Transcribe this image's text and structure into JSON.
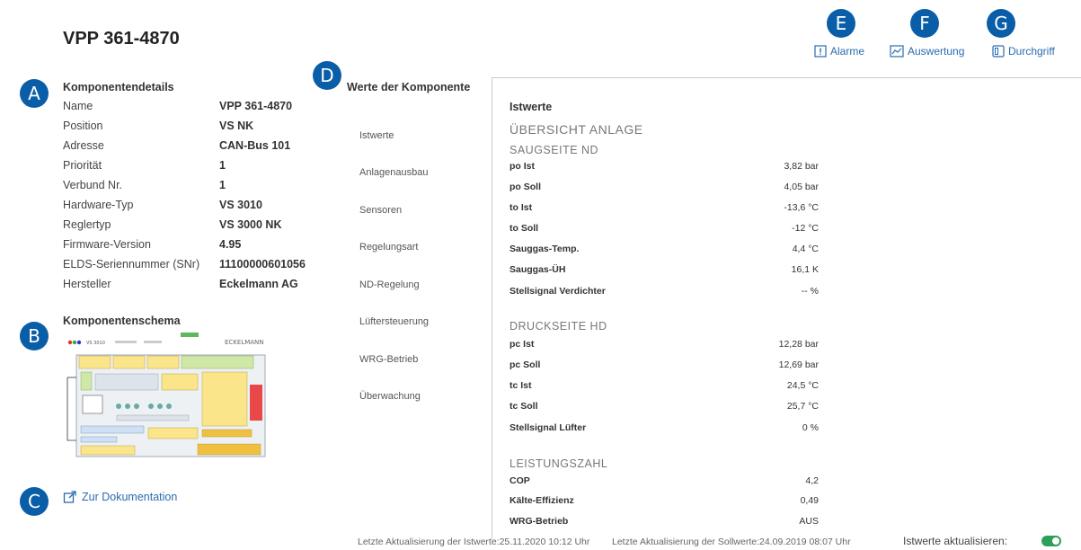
{
  "page_title": "VPP 361-4870",
  "badges": {
    "a": "A",
    "b": "B",
    "c": "C",
    "d": "D",
    "e": "E",
    "f": "F",
    "g": "G"
  },
  "details": {
    "heading": "Komponentendetails",
    "rows": [
      {
        "label": "Name",
        "value": "VPP 361-4870"
      },
      {
        "label": "Position",
        "value": "VS NK"
      },
      {
        "label": "Adresse",
        "value": "CAN-Bus 101"
      },
      {
        "label": "Priorität",
        "value": "1"
      },
      {
        "label": "Verbund Nr.",
        "value": "1"
      },
      {
        "label": "Hardware-Typ",
        "value": "VS 3010"
      },
      {
        "label": "Reglertyp",
        "value": "VS 3000 NK"
      },
      {
        "label": "Firmware-Version",
        "value": "4.95"
      },
      {
        "label": "ELDS-Seriennummer (SNr)",
        "value": "11100000601056"
      },
      {
        "label": "Hersteller",
        "value": "Eckelmann AG"
      }
    ]
  },
  "schema": {
    "heading": "Komponentenschema",
    "model": "VS 3010",
    "brand": "ECKELMANN"
  },
  "doc_link": "Zur Dokumentation",
  "actions": {
    "alarme": "Alarme",
    "auswertung": "Auswertung",
    "durchgriff": "Durchgriff"
  },
  "werte": {
    "title": "Werte der Komponente",
    "nav": [
      "Istwerte",
      "Anlagenausbau",
      "Sensoren",
      "Regelungsart",
      "ND-Regelung",
      "Lüftersteuerung",
      "WRG-Betrieb",
      "Überwachung"
    ]
  },
  "istwerte": {
    "title": "Istwerte",
    "overview": "ÜBERSICHT ANLAGE",
    "saug": {
      "heading": "SAUGSEITE ND",
      "rows": [
        {
          "label": "po Ist",
          "value": "3,82 bar"
        },
        {
          "label": "po Soll",
          "value": "4,05 bar"
        },
        {
          "label": "to Ist",
          "value": "-13,6 °C"
        },
        {
          "label": "to Soll",
          "value": "-12 °C"
        },
        {
          "label": "Sauggas-Temp.",
          "value": "4,4 °C"
        },
        {
          "label": "Sauggas-ÜH",
          "value": "16,1 K"
        },
        {
          "label": "Stellsignal Verdichter",
          "value": "-- %"
        }
      ]
    },
    "druck": {
      "heading": "DRUCKSEITE HD",
      "rows": [
        {
          "label": "pc Ist",
          "value": "12,28 bar"
        },
        {
          "label": "pc Soll",
          "value": "12,69 bar"
        },
        {
          "label": "tc Ist",
          "value": "24,5 °C"
        },
        {
          "label": "tc Soll",
          "value": "25,7 °C"
        },
        {
          "label": "Stellsignal Lüfter",
          "value": "0 %"
        }
      ]
    },
    "leistung": {
      "heading": "LEISTUNGSZAHL",
      "rows": [
        {
          "label": "COP",
          "value": "4,2"
        },
        {
          "label": "Kälte-Effizienz",
          "value": "0,49"
        },
        {
          "label": "WRG-Betrieb",
          "value": "AUS"
        }
      ]
    }
  },
  "footer": {
    "ist_update": "Letzte Aktualisierung der Istwerte:25.11.2020 10:12 Uhr",
    "soll_update": "Letzte Aktualisierung der Sollwerte:24.09.2019 08:07 Uhr",
    "auto_label": "Istwerte aktualisieren:",
    "auto_on": true
  },
  "colors": {
    "badge": "#0a5ea8",
    "link": "#2a6bb0",
    "toggle_on": "#2e9e5b"
  }
}
